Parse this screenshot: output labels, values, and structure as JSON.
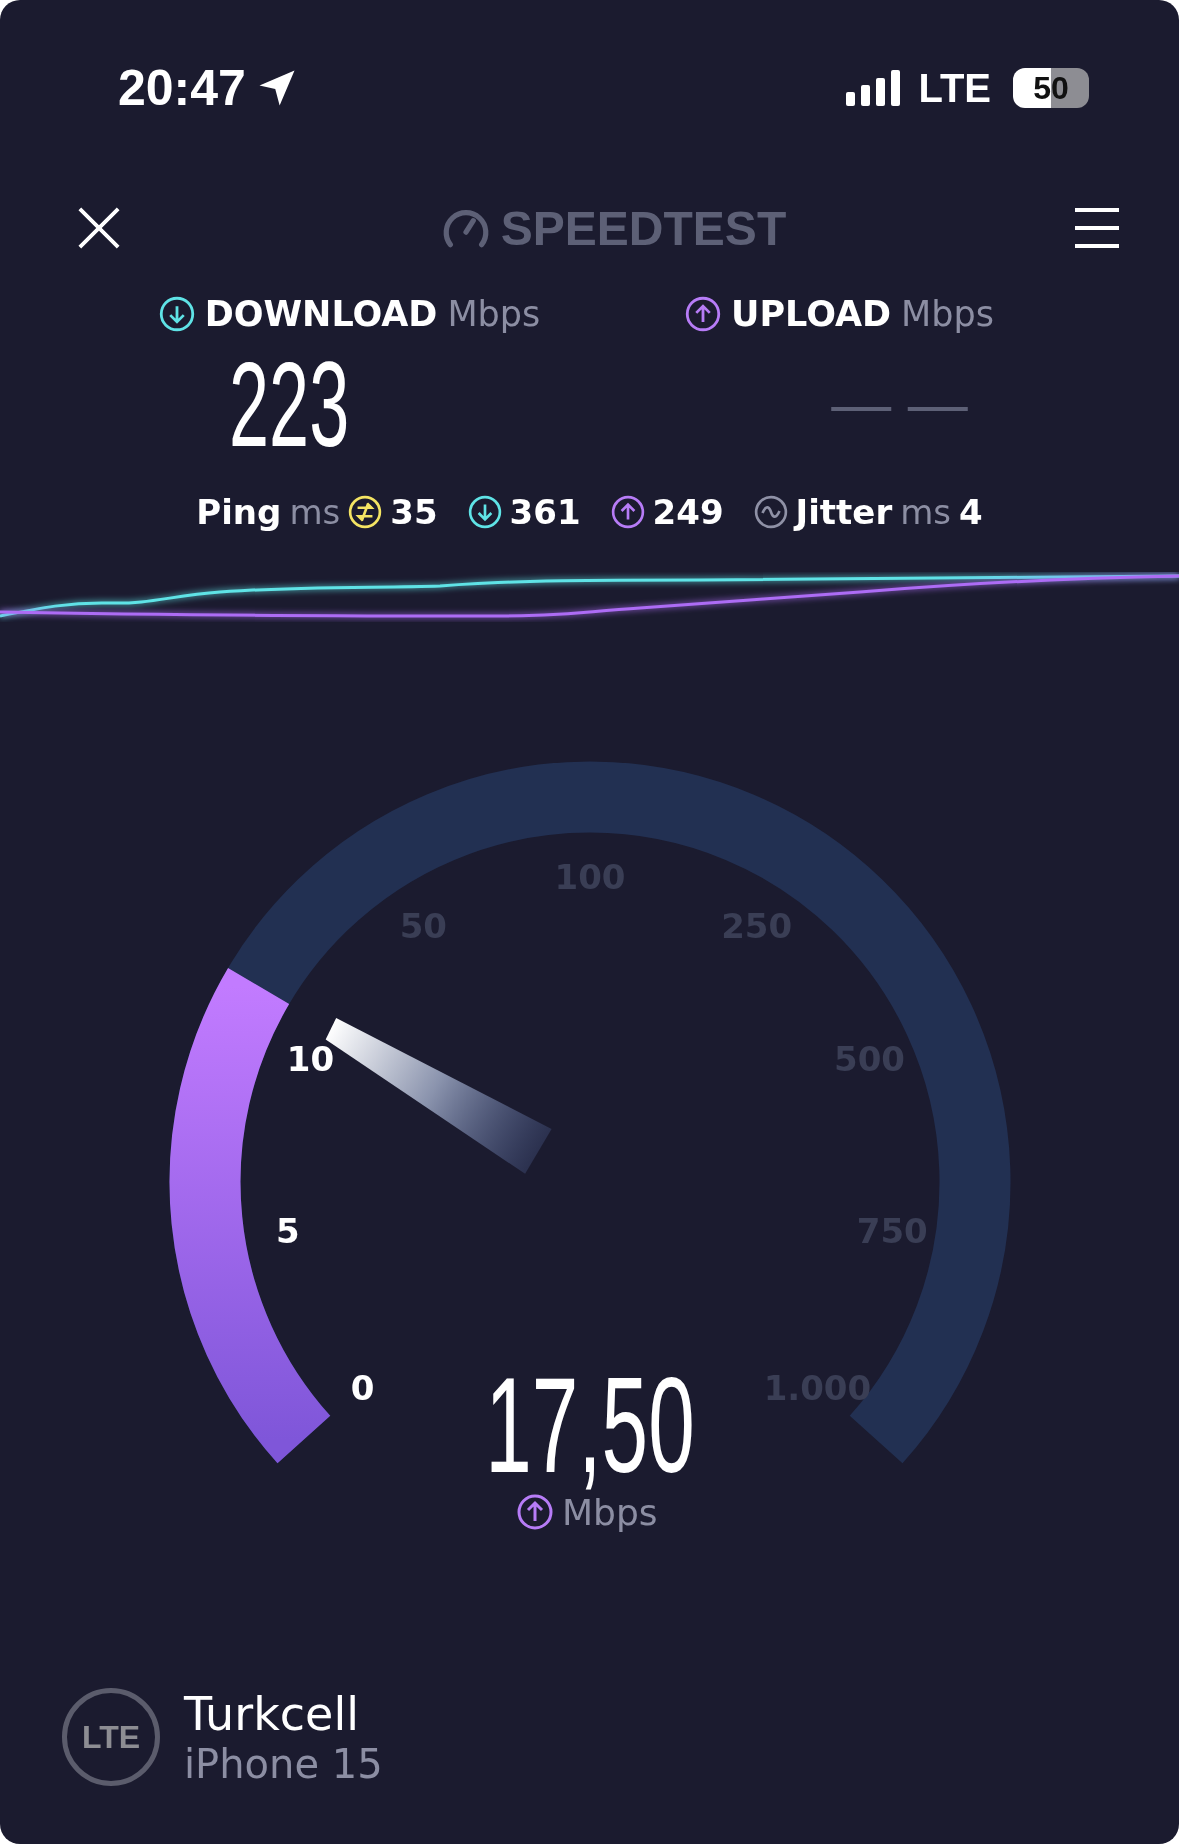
{
  "status_bar": {
    "time": "20:47",
    "network": "LTE",
    "battery": "50"
  },
  "header": {
    "logo": "SPEEDTEST"
  },
  "results": [
    {
      "kind": "download",
      "label": "DOWNLOAD",
      "unit": "Mbps",
      "value": "223"
    },
    {
      "kind": "upload",
      "label": "UPLOAD",
      "unit": "Mbps",
      "value": "— —"
    }
  ],
  "metrics": [
    {
      "kind": "ping",
      "label": "Ping",
      "unit": "ms",
      "value": "35"
    },
    {
      "kind": "download",
      "value": "361"
    },
    {
      "kind": "upload",
      "value": "249"
    },
    {
      "kind": "jitter",
      "label": "Jitter",
      "unit": "ms",
      "value": "4"
    }
  ],
  "gauge": {
    "reading": "17,50",
    "unit": "Mbps",
    "ticks": [
      {
        "label": "0",
        "passed": true
      },
      {
        "label": "5",
        "passed": true
      },
      {
        "label": "10",
        "passed": true
      },
      {
        "label": "50",
        "passed": false
      },
      {
        "label": "100",
        "passed": false
      },
      {
        "label": "250",
        "passed": false
      },
      {
        "label": "500",
        "passed": false
      },
      {
        "label": "750",
        "passed": false
      },
      {
        "label": "1.000",
        "passed": false
      }
    ]
  },
  "server": {
    "network": "LTE",
    "carrier": "Turkcell",
    "device": "iPhone 15"
  }
}
